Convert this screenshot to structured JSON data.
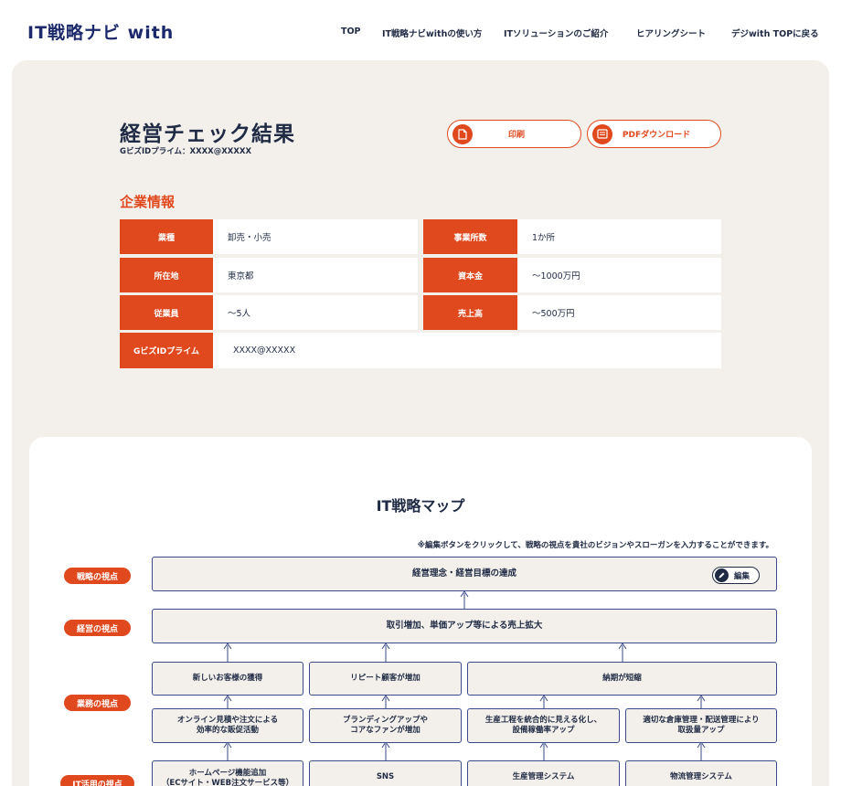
{
  "header": {
    "logo_text": "IT戦略ナビ",
    "logo_with": "with",
    "nav": [
      "TOP",
      "IT戦略ナビwithの使い方",
      "ITソリューションのご紹介",
      "ヒアリングシート",
      "デジwith TOPに戻る"
    ]
  },
  "result": {
    "title": "経営チェック結果",
    "subtitle": "GビズIDプライム：XXXX@XXXXX",
    "print_label": "印刷",
    "pdf_label": "PDFダウンロード"
  },
  "company": {
    "section_title": "企業情報",
    "rows": [
      {
        "label": "業種",
        "value": "卸売・小売"
      },
      {
        "label": "事業所数",
        "value": "1か所"
      },
      {
        "label": "所在地",
        "value": "東京都"
      },
      {
        "label": "資本金",
        "value": "〜1000万円"
      },
      {
        "label": "従業員",
        "value": "〜5人"
      },
      {
        "label": "売上高",
        "value": "〜500万円"
      },
      {
        "label": "GビズIDプライム",
        "value": "XXXX@XXXXX"
      }
    ]
  },
  "map": {
    "title": "IT戦略マップ",
    "note": "※編集ボタンをクリックして、戦略の視点を貴社のビジョンやスローガンを入力することができます。",
    "edit_label": "編集",
    "perspectives": [
      "戦略の視点",
      "経営の視点",
      "業務の視点",
      "IT活用の視点"
    ],
    "strategy": "経営理念・経営目標の達成",
    "management": "取引増加、単価アップ等による売上拡大",
    "business_top": [
      "新しいお客様の獲得",
      "リピート顧客が増加",
      "納期が短縮"
    ],
    "business_bottom": [
      "オンライン見積や注文による\n効率的な販促活動",
      "ブランディングアップや\nコアなファンが増加",
      "生産工程を統合的に見える化し、\n設備稼働率アップ",
      "適切な倉庫管理・配送管理により\n取扱量アップ"
    ],
    "it_tools": [
      "ホームページ機能追加\n（ECサイト・WEB注文サービス等）",
      "SNS",
      "生産管理システム",
      "物流管理システム"
    ]
  },
  "colors": {
    "accent": "#e0481e",
    "navy": "#1f2a44",
    "panel_bg": "#f3f0eb"
  }
}
